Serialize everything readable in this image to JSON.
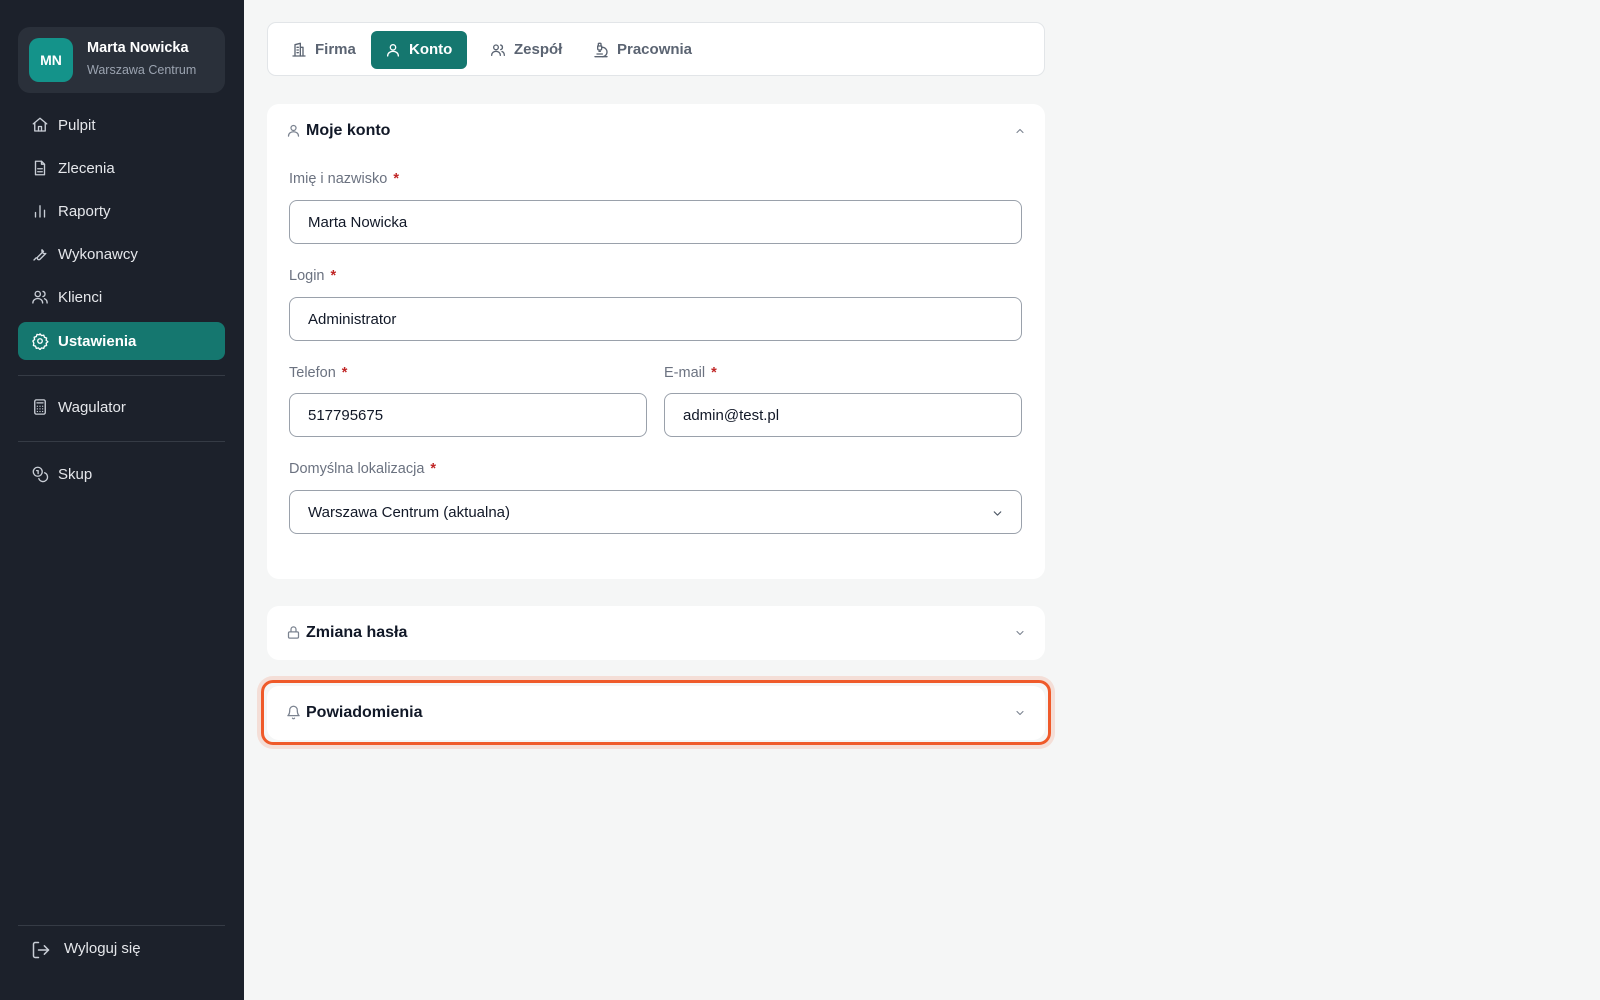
{
  "user": {
    "initials": "MN",
    "name": "Marta Nowicka",
    "location": "Warszawa Centrum"
  },
  "sidebar": {
    "items": [
      {
        "label": "Pulpit",
        "icon": "home-icon"
      },
      {
        "label": "Zlecenia",
        "icon": "document-icon"
      },
      {
        "label": "Raporty",
        "icon": "bar-chart-icon"
      },
      {
        "label": "Wykonawcy",
        "icon": "wrench-icon"
      },
      {
        "label": "Klienci",
        "icon": "users-icon"
      },
      {
        "label": "Ustawienia",
        "icon": "gear-icon",
        "active": true
      },
      {
        "label": "Wagulator",
        "icon": "calculator-icon"
      },
      {
        "label": "Skup",
        "icon": "coins-icon"
      }
    ],
    "logout_label": "Wyloguj się"
  },
  "tabs": [
    {
      "label": "Firma",
      "icon": "building-icon"
    },
    {
      "label": "Konto",
      "icon": "user-icon",
      "active": true
    },
    {
      "label": "Zespół",
      "icon": "users-icon"
    },
    {
      "label": "Pracownia",
      "icon": "microscope-icon"
    }
  ],
  "account": {
    "title": "Moje konto",
    "required_mark": "*",
    "fields": {
      "fullname": {
        "label": "Imię i nazwisko",
        "value": "Marta Nowicka"
      },
      "login": {
        "label": "Login",
        "value": "Administrator"
      },
      "phone": {
        "label": "Telefon",
        "value": "517795675"
      },
      "email": {
        "label": "E-mail",
        "value": "admin@test.pl"
      },
      "location": {
        "label": "Domyślna lokalizacja",
        "value": "Warszawa Centrum (aktualna)"
      }
    }
  },
  "password_section": {
    "title": "Zmiana hasła"
  },
  "notifications_section": {
    "title": "Powiadomienia"
  },
  "colors": {
    "accent": "#15776f",
    "sidebar_bg": "#1c212b",
    "highlight": "#ef5a2a",
    "required": "#c02626"
  }
}
